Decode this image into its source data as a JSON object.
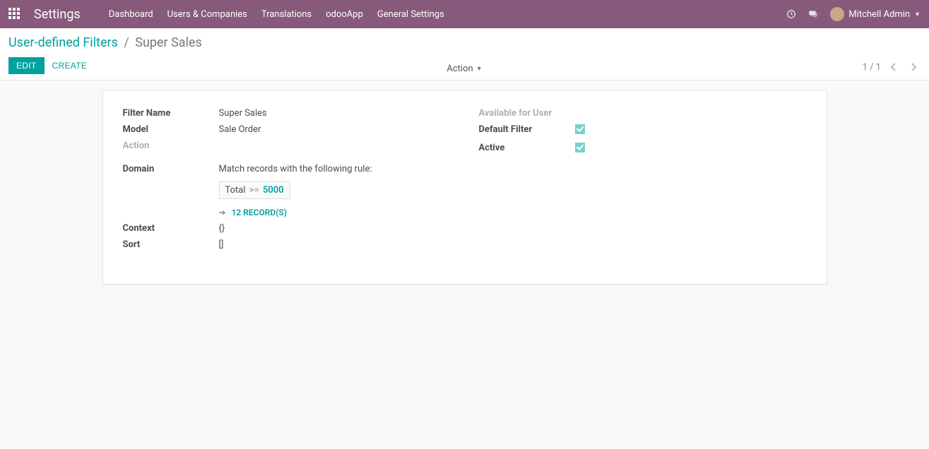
{
  "navbar": {
    "brand": "Settings",
    "menu": [
      "Dashboard",
      "Users & Companies",
      "Translations",
      "odooApp",
      "General Settings"
    ],
    "user": "Mitchell Admin"
  },
  "breadcrumb": {
    "parent": "User-defined Filters",
    "current": "Super Sales"
  },
  "buttons": {
    "edit": "EDIT",
    "create": "CREATE"
  },
  "action_menu": "Action",
  "pager": "1 / 1",
  "form": {
    "left": {
      "filter_name_label": "Filter Name",
      "filter_name": "Super Sales",
      "model_label": "Model",
      "model": "Sale Order",
      "action_label": "Action",
      "action": "",
      "domain_label": "Domain",
      "domain_desc": "Match records with the following rule:",
      "domain_field": "Total",
      "domain_op": ">=",
      "domain_val": "5000",
      "records_link": "12 RECORD(S)",
      "context_label": "Context",
      "context": "{}",
      "sort_label": "Sort",
      "sort": "[]"
    },
    "right": {
      "avail_user_label": "Available for User",
      "avail_user": "",
      "default_filter_label": "Default Filter",
      "active_label": "Active"
    }
  }
}
